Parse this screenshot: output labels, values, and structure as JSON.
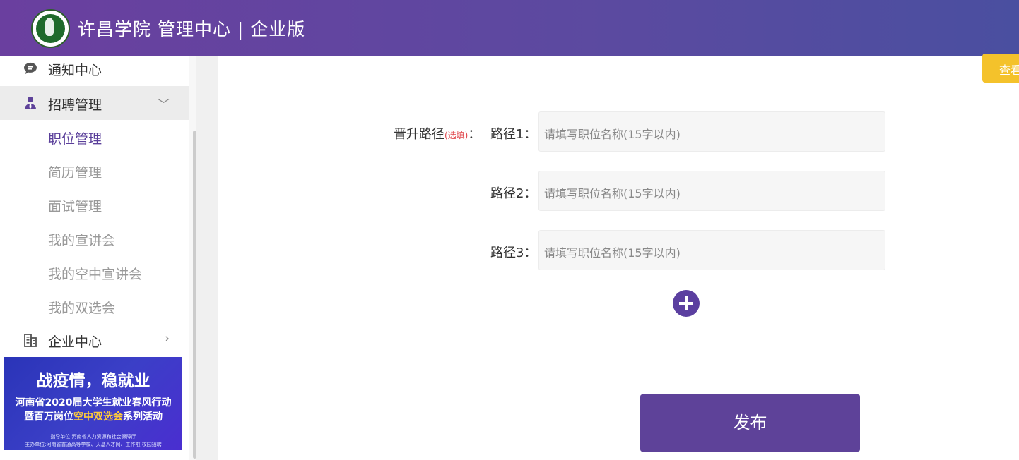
{
  "header": {
    "title": "许昌学院 管理中心 | 企业版"
  },
  "sidebar": {
    "items": [
      {
        "label": "通知中心"
      },
      {
        "label": "招聘管理"
      },
      {
        "label": "企业中心"
      }
    ],
    "subitems": [
      "职位管理",
      "简历管理",
      "面试管理",
      "我的宣讲会",
      "我的空中宣讲会",
      "我的双选会"
    ]
  },
  "banner": {
    "line1": "战疫情，稳就业",
    "line2": "河南省2020届大学生就业春风行动",
    "line3_pre": "暨百万岗位",
    "line3_hl": "空中双选会",
    "line3_post": "系列活动",
    "line4": "指导单位:河南省人力资源和社会保障厅",
    "line5": "主办单位:河南省普通高等学校、天基人才网、工作啦·校园招聘"
  },
  "main": {
    "view_button": "查看",
    "promotion_label": "晋升路径",
    "promotion_optional": "(选填)",
    "label_colon": "：",
    "paths": [
      {
        "label": "路径1：",
        "placeholder": "请填写职位名称(15字以内)"
      },
      {
        "label": "路径2：",
        "placeholder": "请填写职位名称(15字以内)"
      },
      {
        "label": "路径3：",
        "placeholder": "请填写职位名称(15字以内)"
      }
    ],
    "publish_label": "发布"
  },
  "colors": {
    "header": "#6a3f9f",
    "accent": "#5e4299",
    "warning": "#f4c22b"
  }
}
